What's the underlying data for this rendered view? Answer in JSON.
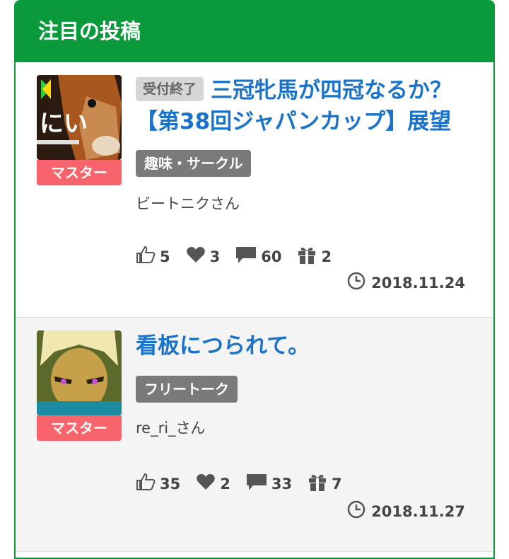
{
  "panel": {
    "title": "注目の投稿"
  },
  "posts": [
    {
      "closed_badge": "受付終了",
      "title": "三冠牝馬が四冠なるか？【第38回ジャパンカップ】展望",
      "category": "趣味・サークル",
      "author": "ビートニクさん",
      "rank": "マスター",
      "likes": "5",
      "hearts": "3",
      "comments": "60",
      "gifts": "2",
      "date": "2018.11.24",
      "avatar_text": "にい"
    },
    {
      "title": "看板につられて。",
      "category": "フリートーク",
      "author": "re_ri_さん",
      "rank": "マスター",
      "likes": "35",
      "hearts": "2",
      "comments": "33",
      "gifts": "7",
      "date": "2018.11.27"
    }
  ],
  "colors": {
    "header_green": "#0a9a3c",
    "title_blue": "#1a73c9",
    "rank_red": "#f7646c",
    "category_gray": "#7a7a7a"
  },
  "icons": [
    "thumbs-up-icon",
    "heart-icon",
    "comment-icon",
    "gift-icon",
    "clock-icon"
  ]
}
